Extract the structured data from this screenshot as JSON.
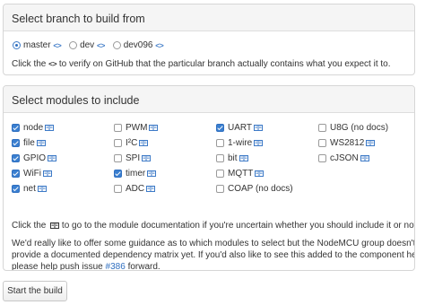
{
  "branch_panel": {
    "title": "Select branch to build from",
    "options": [
      {
        "label": "master",
        "selected": true
      },
      {
        "label": "dev",
        "selected": false
      },
      {
        "label": "dev096",
        "selected": false
      }
    ],
    "code_icon": "<>",
    "help_before": "Click the",
    "help_after": "to verify on GitHub that the particular branch actually contains what you expect it to."
  },
  "modules_panel": {
    "title": "Select modules to include",
    "columns": [
      [
        {
          "label": "node",
          "checked": true,
          "doc": true
        },
        {
          "label": "file",
          "checked": true,
          "doc": true
        },
        {
          "label": "GPIO",
          "checked": true,
          "doc": true
        },
        {
          "label": "WiFi",
          "checked": true,
          "doc": true
        },
        {
          "label": "net",
          "checked": true,
          "doc": true
        }
      ],
      [
        {
          "label": "PWM",
          "checked": false,
          "doc": true
        },
        {
          "label": "I²C",
          "checked": false,
          "doc": true
        },
        {
          "label": "SPI",
          "checked": false,
          "doc": true
        },
        {
          "label": "timer",
          "checked": true,
          "doc": true
        },
        {
          "label": "ADC",
          "checked": false,
          "doc": true
        }
      ],
      [
        {
          "label": "UART",
          "checked": true,
          "doc": true
        },
        {
          "label": "1-wire",
          "checked": false,
          "doc": true
        },
        {
          "label": "bit",
          "checked": false,
          "doc": true
        },
        {
          "label": "MQTT",
          "checked": false,
          "doc": true
        },
        {
          "label": "COAP (no docs)",
          "checked": false,
          "doc": false
        }
      ],
      [
        {
          "label": "U8G (no docs)",
          "checked": false,
          "doc": false
        },
        {
          "label": "WS2812",
          "checked": false,
          "doc": true
        },
        {
          "label": "cJSON",
          "checked": false,
          "doc": true
        }
      ]
    ],
    "doc_help_before": "Click the",
    "doc_help_after": "to go to the module documentation if you're uncertain whether you should include it or not.",
    "guidance_line1": "We'd really like to offer some guidance as to which modules to select but the NodeMCU group doesn't",
    "guidance_line2": "provide a documented dependency matrix yet. If you'd also like to see this added to the component here",
    "guidance_line3_before": "please help push issue",
    "guidance_issue_link": "#386",
    "guidance_line3_after": "forward."
  },
  "start_button": "Start the build",
  "colors": {
    "accent": "#2f6fc0",
    "panel_heading_bg": "#f5f5f5",
    "border": "#d6d6d6"
  },
  "icons": {
    "code": "code-brackets-icon",
    "doc": "book-icon"
  }
}
